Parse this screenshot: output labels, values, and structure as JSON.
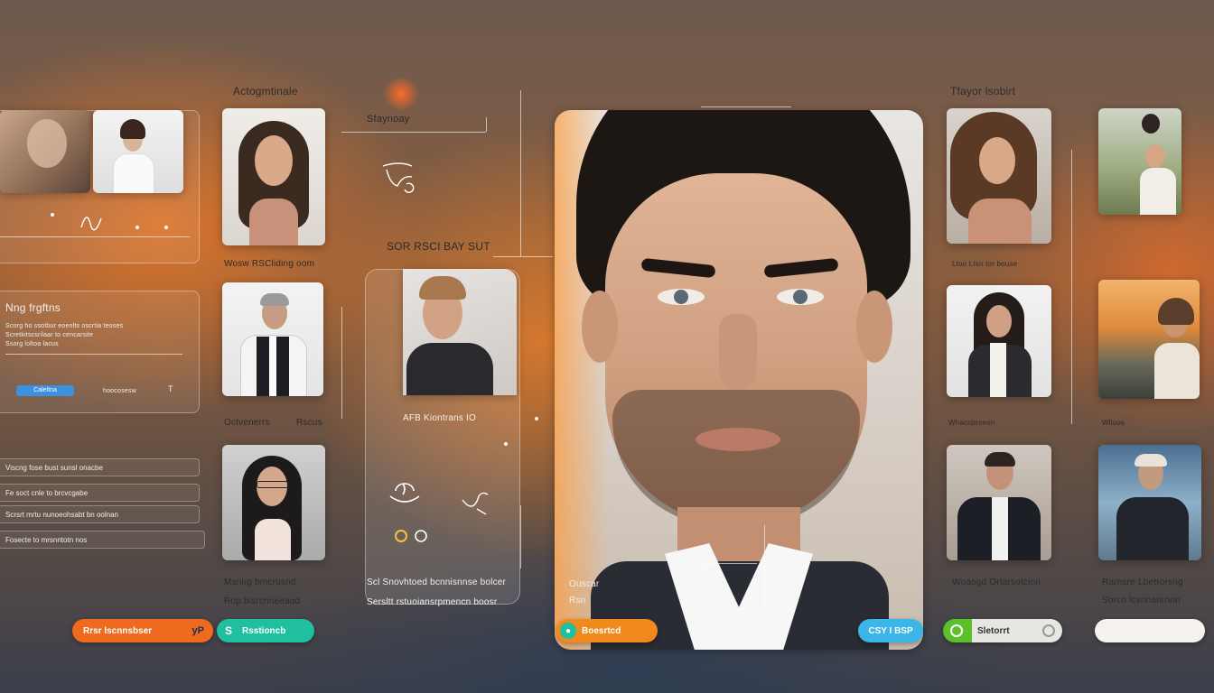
{
  "titles": {
    "left_column": "Actogmtinale",
    "mid_small": "Sfaynoay",
    "mid_heading": "SOR RSCI BAY SUT",
    "right_column": "Tfayor lsobirt"
  },
  "left_panel": {
    "heading": "Nng frgftns",
    "lines": [
      "Scorg ho ssotbur eoenlts oscrtia teoses",
      "Scretkitscsrilaar to cencarsite",
      "Ssorg loltoa lacus"
    ],
    "button": "Caleltna",
    "aside": "hoocosesw"
  },
  "list_panel": {
    "items": [
      "Viscng fose bust sunsl onacbe",
      "Fe soct cnle to brcvcgabe",
      "Scrsrt mrtu nunoeohsabt bn oolnan",
      "Fosecte to mrsnntotn nos"
    ]
  },
  "photo_captions": {
    "c1": "Wosw RSCliding oom",
    "c2a": "Octvenerrs",
    "c2b": "Rscus",
    "c3": "Msnirg bmcrusnd",
    "c3b": "Rop bisrchneeaod",
    "mid_card": "AFB Kiontrans IO",
    "mid_b1": "Scl Snovhtoed bcnnisnnse bolcer",
    "mid_b2": "Sersltt rstuoiansrpmencn boosr",
    "center_a": "Ouscar",
    "center_b": "Rsn",
    "r1": "Ltoo Ltsn tor bouse",
    "r2": "Whacnbrseon",
    "r2b": "Wlloos",
    "r3": "Woaogd Ortarsotcion",
    "r4a": "Rarnsre Lbetrorsng",
    "r4b": "Sorco lcvnnanrnon"
  },
  "bottom_buttons": [
    {
      "label": "Rrsr lscnnsbser",
      "badge": "yP",
      "color": "#ee6a1f"
    },
    {
      "label": "Rsstioncb",
      "icon": "S",
      "color": "#1fbf9f"
    },
    {
      "label": "Boesrtcd",
      "icon": "user-icon",
      "color": "#f08a1c"
    },
    {
      "label": "CSY I BSP",
      "color": "#3cb6e8"
    },
    {
      "label": "Sletorrt",
      "icon": "refresh-icon",
      "color": "#5cc02a"
    },
    {
      "label": "",
      "color": "#f4f1ee"
    }
  ],
  "colors": {
    "accent_orange": "#ee6a1f",
    "teal": "#1fbf9f",
    "blue": "#3cb6e8",
    "green": "#5cc02a"
  }
}
